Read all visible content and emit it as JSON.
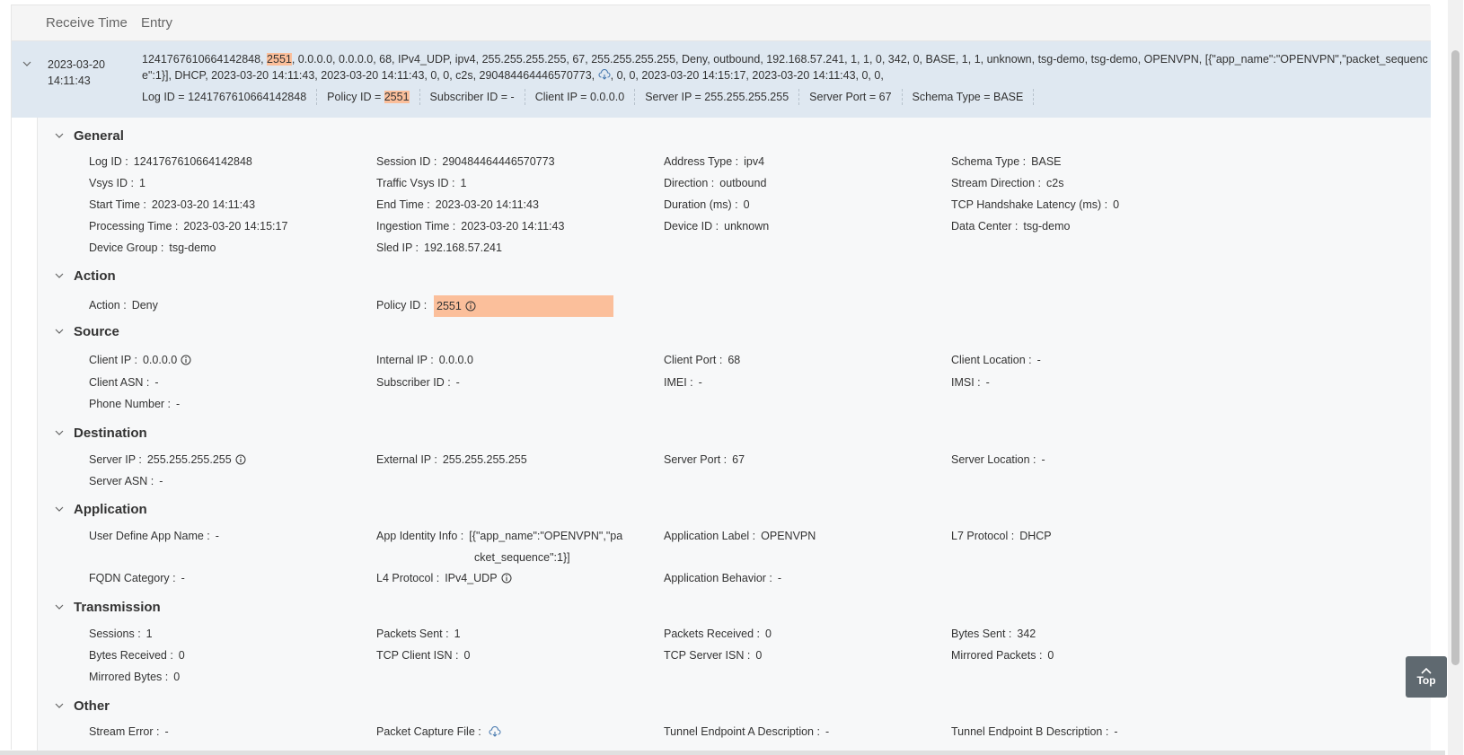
{
  "header": {
    "receive_time": "Receive Time",
    "entry": "Entry"
  },
  "row": {
    "date": "2023-03-20",
    "time": "14:11:43",
    "entry_part1": "1241767610664142848, ",
    "entry_hl": "2551",
    "entry_part2": ", 0.0.0.0, 0.0.0.0, 68, IPv4_UDP, ipv4, 255.255.255.255, 67, 255.255.255.255, Deny, outbound, 192.168.57.241, 1, 1, 0, 342, 0, BASE, 1, 1, unknown, tsg-demo, tsg-demo, OPENVPN, [{\"app_name\":\"OPENVPN\",\"packet_sequence\":1}], DHCP, 2023-03-20 14:11:43, 2023-03-20 14:11:43, 0, 0, c2s, 290484464446570773, ",
    "entry_part3": ", 0, 0, 2023-03-20 14:15:17, 2023-03-20 14:11:43, 0, 0,",
    "pills": {
      "log_id": "Log ID = 1241767610664142848",
      "policy_prefix": "Policy ID = ",
      "policy_val": "2551",
      "subscriber": "Subscriber ID = -",
      "client_ip": "Client IP = 0.0.0.0",
      "server_ip": "Server IP = 255.255.255.255",
      "server_port": "Server Port = 67",
      "schema": "Schema Type = BASE"
    }
  },
  "sections": {
    "general": {
      "title": "General",
      "log_id_k": "Log ID :",
      "log_id_v": "1241767610664142848",
      "session_id_k": "Session ID :",
      "session_id_v": "290484464446570773",
      "address_type_k": "Address Type :",
      "address_type_v": "ipv4",
      "schema_type_k": "Schema Type :",
      "schema_type_v": "BASE",
      "vsys_id_k": "Vsys ID :",
      "vsys_id_v": "1",
      "traffic_vsys_k": "Traffic Vsys ID :",
      "traffic_vsys_v": "1",
      "direction_k": "Direction :",
      "direction_v": "outbound",
      "stream_dir_k": "Stream Direction :",
      "stream_dir_v": "c2s",
      "start_time_k": "Start Time :",
      "start_time_v": "2023-03-20 14:11:43",
      "end_time_k": "End Time :",
      "end_time_v": "2023-03-20 14:11:43",
      "duration_k": "Duration (ms) :",
      "duration_v": "0",
      "tcp_hs_k": "TCP Handshake Latency (ms) :",
      "tcp_hs_v": "0",
      "processing_k": "Processing Time :",
      "processing_v": "2023-03-20 14:15:17",
      "ingestion_k": "Ingestion Time :",
      "ingestion_v": "2023-03-20 14:11:43",
      "device_id_k": "Device ID :",
      "device_id_v": "unknown",
      "data_center_k": "Data Center :",
      "data_center_v": "tsg-demo",
      "device_group_k": "Device Group :",
      "device_group_v": "tsg-demo",
      "sled_ip_k": "Sled IP :",
      "sled_ip_v": "192.168.57.241"
    },
    "action": {
      "title": "Action",
      "action_k": "Action :",
      "action_v": "Deny",
      "policy_k": "Policy ID :",
      "policy_v": "2551"
    },
    "source": {
      "title": "Source",
      "client_ip_k": "Client IP :",
      "client_ip_v": "0.0.0.0",
      "internal_ip_k": "Internal IP :",
      "internal_ip_v": "0.0.0.0",
      "client_port_k": "Client Port :",
      "client_port_v": "68",
      "client_loc_k": "Client Location :",
      "client_loc_v": "-",
      "client_asn_k": "Client ASN :",
      "client_asn_v": "-",
      "subscriber_k": "Subscriber ID :",
      "subscriber_v": "-",
      "imei_k": "IMEI :",
      "imei_v": "-",
      "imsi_k": "IMSI :",
      "imsi_v": "-",
      "phone_k": "Phone Number :",
      "phone_v": "-"
    },
    "destination": {
      "title": "Destination",
      "server_ip_k": "Server IP :",
      "server_ip_v": "255.255.255.255",
      "external_ip_k": "External IP :",
      "external_ip_v": "255.255.255.255",
      "server_port_k": "Server Port :",
      "server_port_v": "67",
      "server_loc_k": "Server Location :",
      "server_loc_v": "-",
      "server_asn_k": "Server ASN :",
      "server_asn_v": "-"
    },
    "application": {
      "title": "Application",
      "uda_k": "User Define App Name :",
      "uda_v": "-",
      "aii_k": "App Identity Info :",
      "aii_v1": "[{\"app_name\":\"OPENVPN\",\"pa",
      "aii_v2": "cket_sequence\":1}]",
      "app_label_k": "Application Label :",
      "app_label_v": "OPENVPN",
      "l7_k": "L7 Protocol :",
      "l7_v": "DHCP",
      "fqdn_k": "FQDN Category :",
      "fqdn_v": "-",
      "l4_k": "L4 Protocol :",
      "l4_v": "IPv4_UDP",
      "behavior_k": "Application Behavior :",
      "behavior_v": "-"
    },
    "transmission": {
      "title": "Transmission",
      "sessions_k": "Sessions :",
      "sessions_v": "1",
      "pkt_sent_k": "Packets Sent :",
      "pkt_sent_v": "1",
      "pkt_recv_k": "Packets Received :",
      "pkt_recv_v": "0",
      "bytes_sent_k": "Bytes Sent :",
      "bytes_sent_v": "342",
      "bytes_recv_k": "Bytes Received :",
      "bytes_recv_v": "0",
      "tcp_client_k": "TCP Client ISN :",
      "tcp_client_v": "0",
      "tcp_server_k": "TCP Server ISN :",
      "tcp_server_v": "0",
      "mirrored_pkts_k": "Mirrored Packets :",
      "mirrored_pkts_v": "0",
      "mirrored_bytes_k": "Mirrored Bytes :",
      "mirrored_bytes_v": "0"
    },
    "other": {
      "title": "Other",
      "stream_err_k": "Stream Error :",
      "stream_err_v": "-",
      "pcap_k": "Packet Capture File :",
      "tunnel_a_k": "Tunnel Endpoint A Description :",
      "tunnel_a_v": "-",
      "tunnel_b_k": "Tunnel Endpoint B Description :",
      "tunnel_b_v": "-"
    }
  },
  "top_button": {
    "label": "Top"
  },
  "colors": {
    "highlight": "#fbbf9b",
    "row_bg": "#dfe8f1",
    "button_bg": "#5f6970"
  },
  "icons": [
    "chevron-down-icon",
    "info-icon",
    "cloud-download-icon",
    "chevron-up-icon"
  ]
}
